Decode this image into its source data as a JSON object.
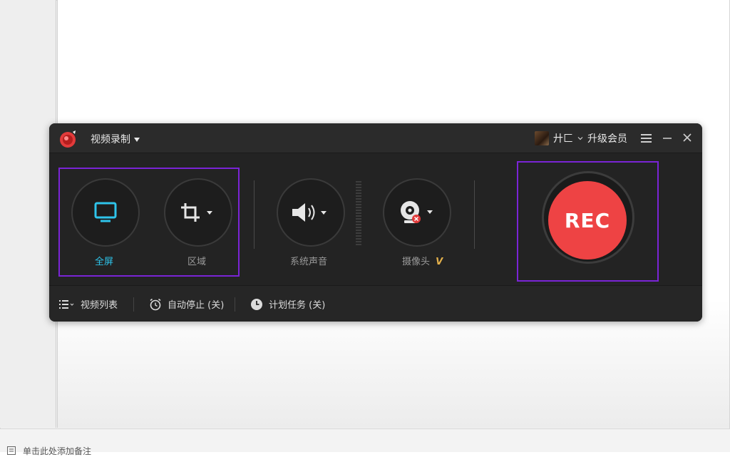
{
  "background": {
    "bottom_hint": "单击此处添加备注"
  },
  "titlebar": {
    "mode": "视频录制",
    "user_name": "廾匚",
    "upgrade_label": "升级会员"
  },
  "controls": {
    "fullscreen_label": "全屏",
    "region_label": "区域",
    "system_audio_label": "系统声音",
    "camera_label": "摄像头",
    "camera_vip_badge": "V"
  },
  "rec_button": {
    "label": "REC"
  },
  "bottombar": {
    "video_list": "视频列表",
    "auto_stop": "自动停止 (关)",
    "scheduled_task": "计划任务 (关)"
  },
  "colors": {
    "accent_cyan": "#2ec4ea",
    "rec_red": "#ee4344",
    "highlight_purple": "#7a24d6",
    "panel_dark": "#232323"
  }
}
